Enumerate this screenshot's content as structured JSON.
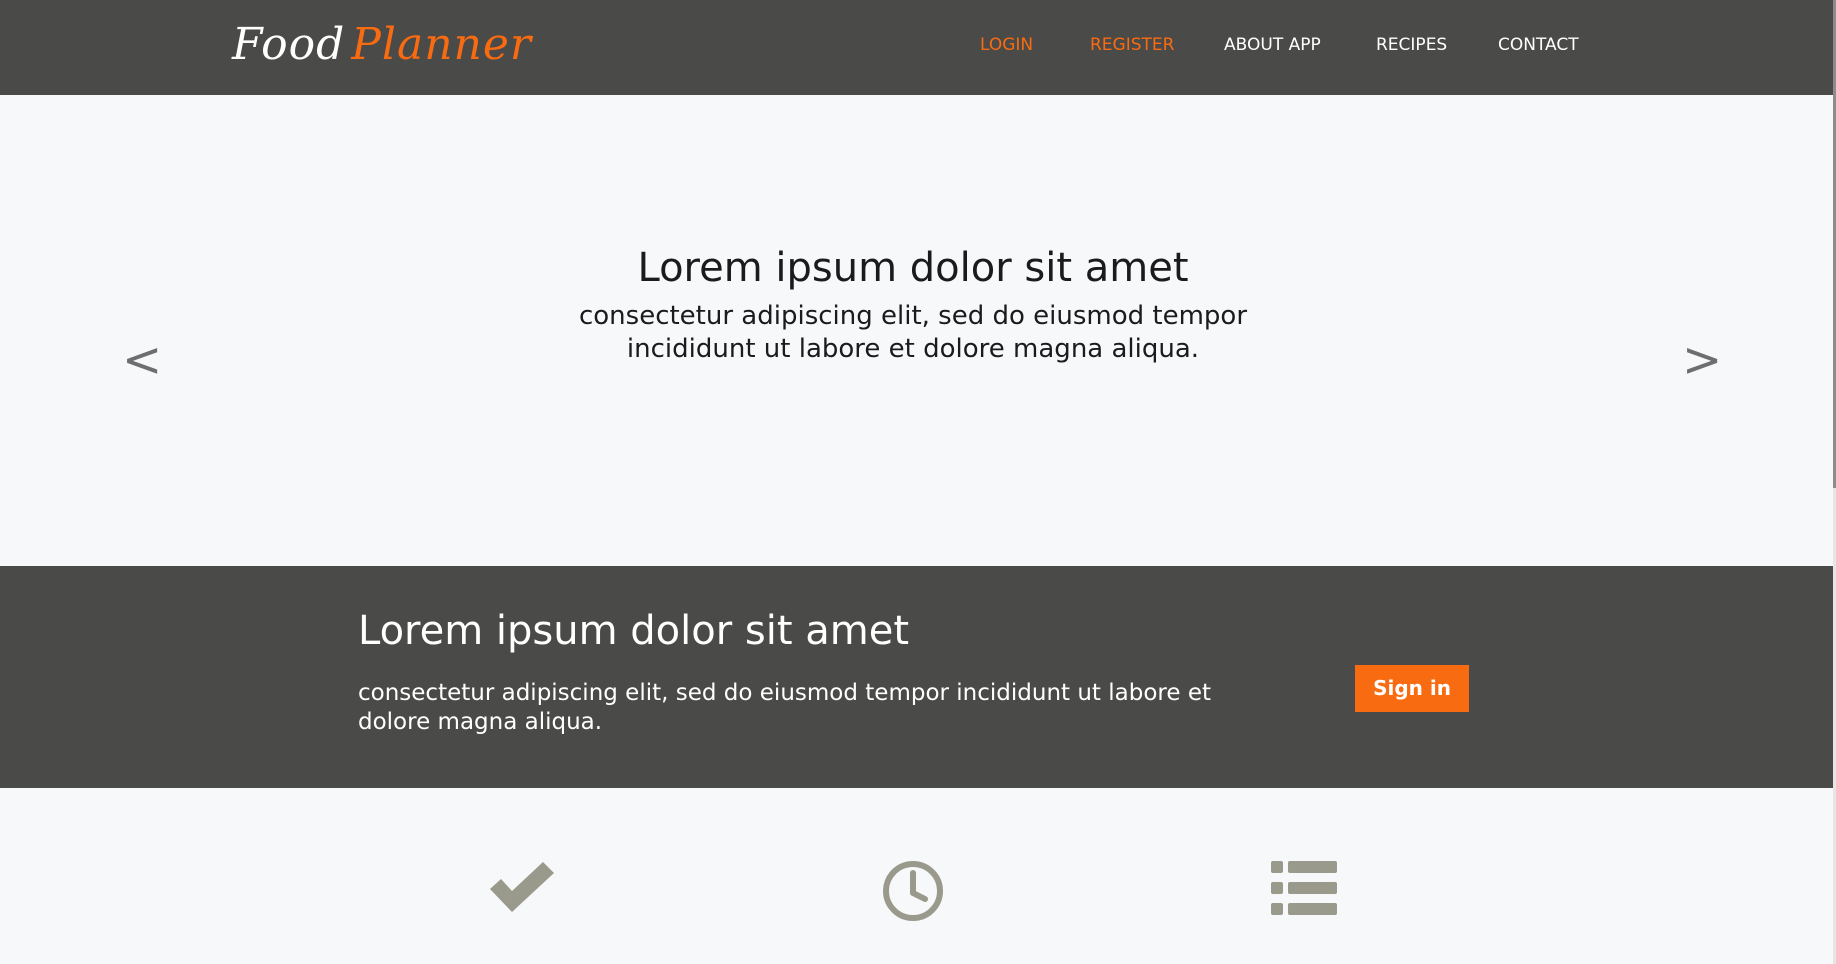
{
  "header": {
    "logo_part1": "Food",
    "logo_part2": "Planner",
    "nav": [
      {
        "label": "LOGIN"
      },
      {
        "label": "REGISTER"
      },
      {
        "label": "ABOUT APP"
      },
      {
        "label": "RECIPES"
      },
      {
        "label": "CONTACT"
      }
    ]
  },
  "hero": {
    "title": "Lorem ipsum dolor sit amet",
    "text": "consectetur adipiscing elit, sed do eiusmod tempor incididunt ut labore et dolore magna aliqua.",
    "prev_label": "<",
    "next_label": ">"
  },
  "cta": {
    "title": "Lorem ipsum dolor sit amet",
    "text": "consectetur adipiscing elit, sed do eiusmod tempor incididunt ut labore et dolore magna aliqua.",
    "button_label": "Sign in"
  },
  "features": {
    "icons": [
      "check-icon",
      "clock-icon",
      "list-icon"
    ]
  },
  "colors": {
    "header_bg": "#4a4a49",
    "accent": "#f96b11",
    "page_bg": "#f7f8fa",
    "icon": "#9a9a8c"
  }
}
